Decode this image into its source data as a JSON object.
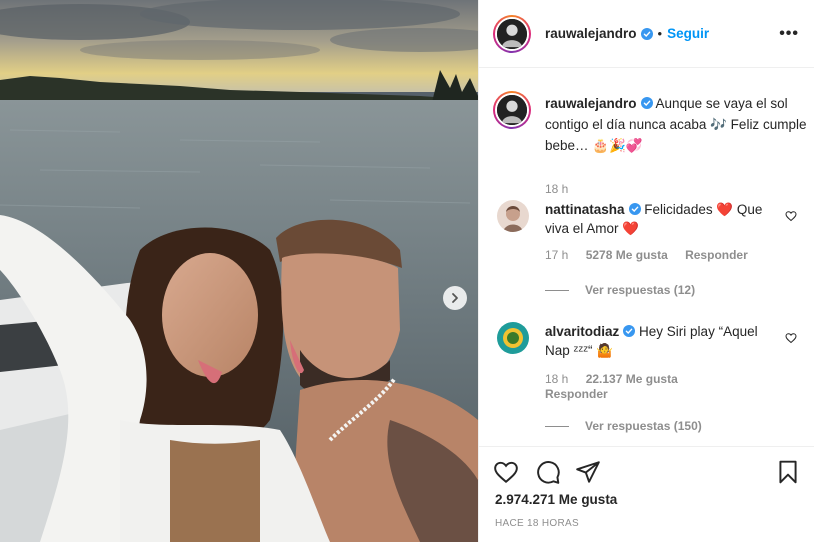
{
  "post": {
    "image_alt": "",
    "next_icon": "chevron-right-icon"
  },
  "header": {
    "username": "rauwalejandro",
    "separator": "•",
    "follow_label": "Seguir",
    "more_label": "•••"
  },
  "caption": {
    "username": "rauwalejandro",
    "text": "Aunque se vaya el sol contigo el día nunca acaba 🎶 Feliz cumple bebe… 🎂🎉💞",
    "time": "18 h"
  },
  "comments": [
    {
      "username": "nattinatasha",
      "text": "Felicidades ❤️ Que viva el Amor ❤️",
      "time": "17 h",
      "likes": "5278 Me gusta",
      "reply_label": "Responder",
      "view_replies": "Ver respuestas (12)"
    },
    {
      "username": "alvaritodiaz",
      "text": "Hey Siri play “Aquel Nap ᶻᶻᶻ“ 🤷",
      "time": "18 h",
      "likes": "22.137 Me gusta",
      "reply_label": "Responder",
      "view_replies": "Ver respuestas (150)"
    }
  ],
  "actions": {
    "likes_count": "2.974.271 Me gusta",
    "posted_time": "HACE 18 HORAS"
  },
  "colors": {
    "accent": "#0095f6",
    "text": "#262626",
    "muted": "#8e8e8e",
    "heart": "#ed4956"
  }
}
